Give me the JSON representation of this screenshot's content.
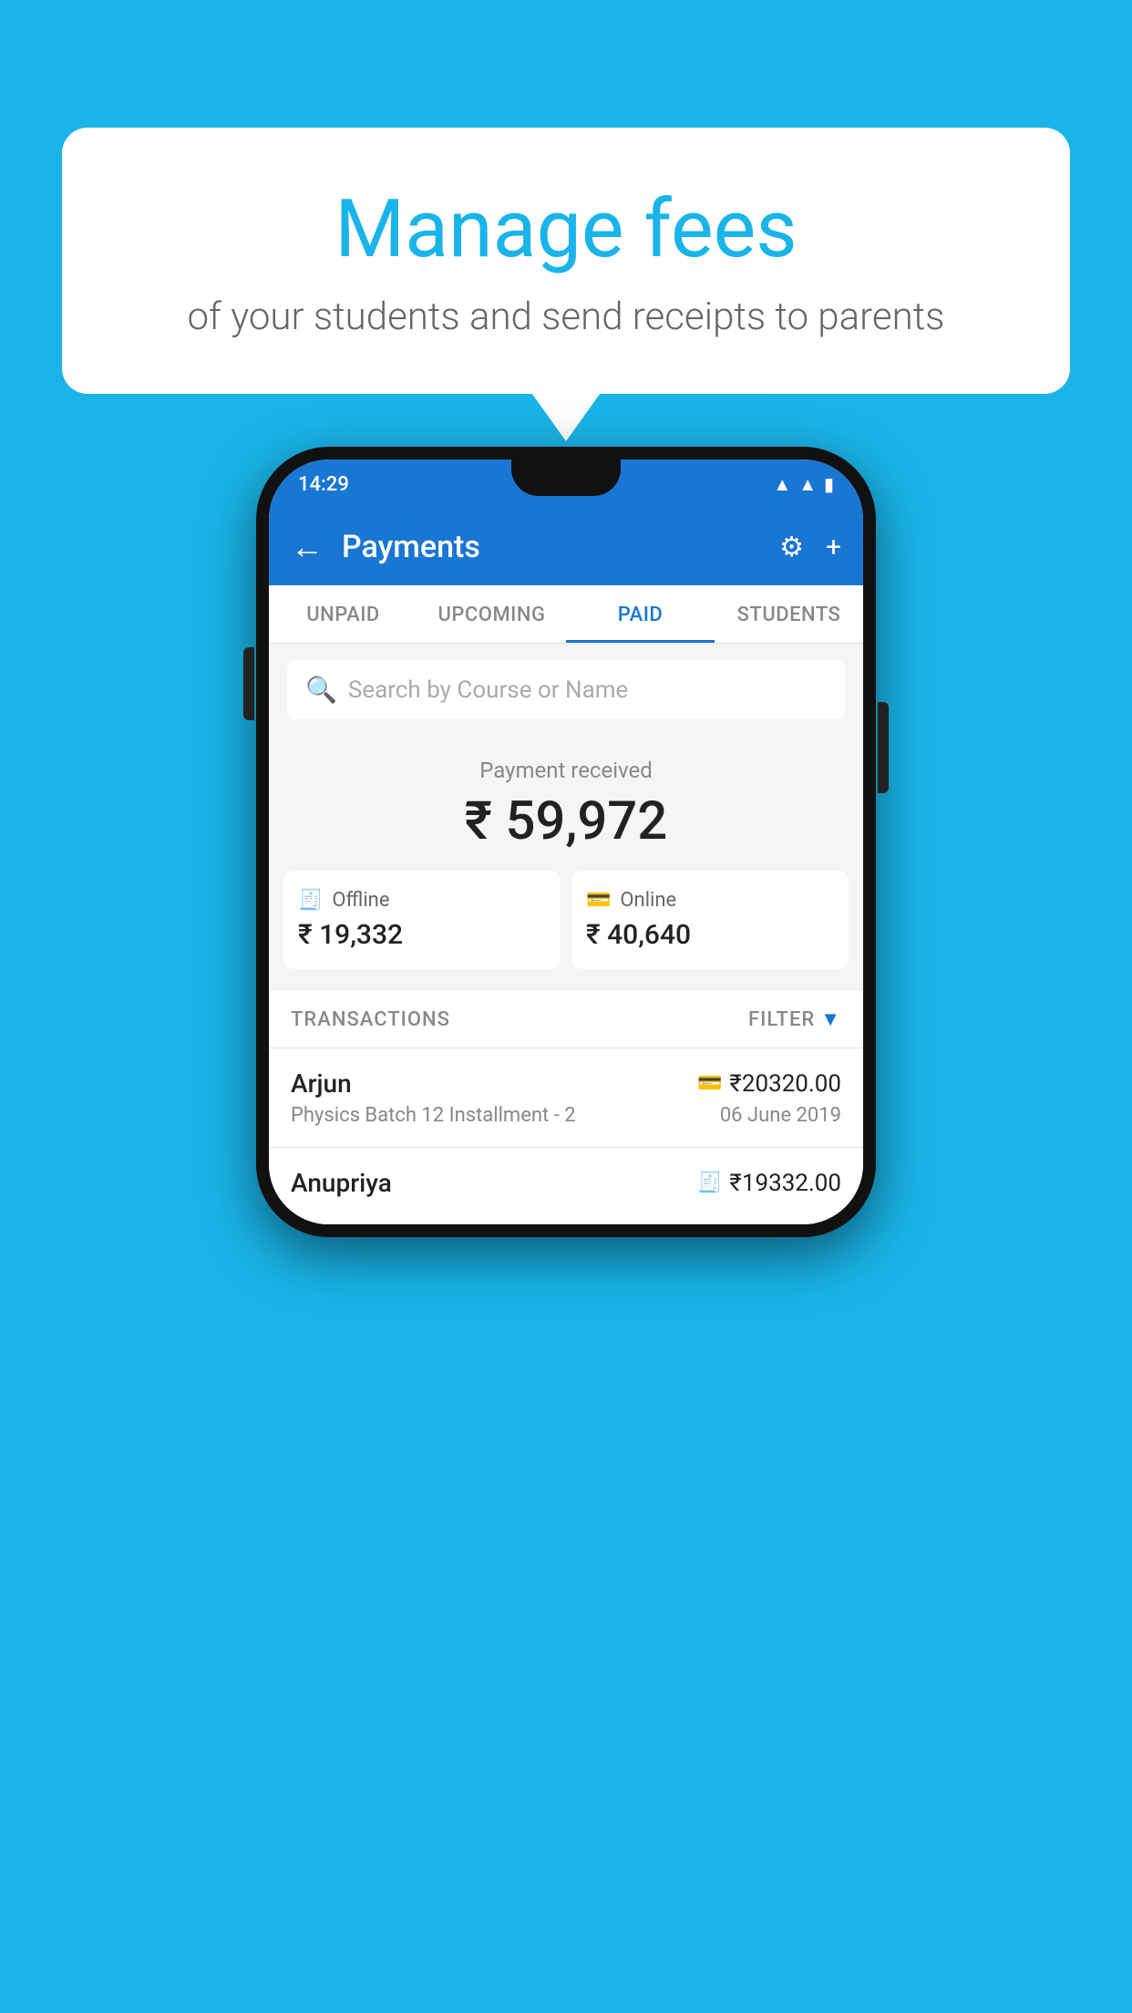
{
  "background_color": "#1ab4e8",
  "speech_bubble": {
    "title": "Manage fees",
    "subtitle": "of your students and send receipts to parents"
  },
  "status_bar": {
    "time": "14:29",
    "icons": [
      "wifi",
      "signal",
      "battery"
    ]
  },
  "app_bar": {
    "title": "Payments",
    "back_label": "←",
    "settings_label": "⚙",
    "add_label": "+"
  },
  "tabs": [
    {
      "label": "UNPAID",
      "active": false
    },
    {
      "label": "UPCOMING",
      "active": false
    },
    {
      "label": "PAID",
      "active": true
    },
    {
      "label": "STUDENTS",
      "active": false
    }
  ],
  "search": {
    "placeholder": "Search by Course or Name"
  },
  "payment_summary": {
    "label": "Payment received",
    "amount": "₹ 59,972"
  },
  "payment_cards": [
    {
      "type": "Offline",
      "icon": "🧾",
      "amount": "₹ 19,332"
    },
    {
      "type": "Online",
      "icon": "💳",
      "amount": "₹ 40,640"
    }
  ],
  "transactions_header": {
    "label": "TRANSACTIONS",
    "filter_label": "FILTER"
  },
  "transactions": [
    {
      "name": "Arjun",
      "course": "Physics Batch 12 Installment - 2",
      "amount": "₹20320.00",
      "date": "06 June 2019",
      "payment_type": "online"
    },
    {
      "name": "Anupriya",
      "course": "",
      "amount": "₹19332.00",
      "date": "",
      "payment_type": "offline"
    }
  ]
}
